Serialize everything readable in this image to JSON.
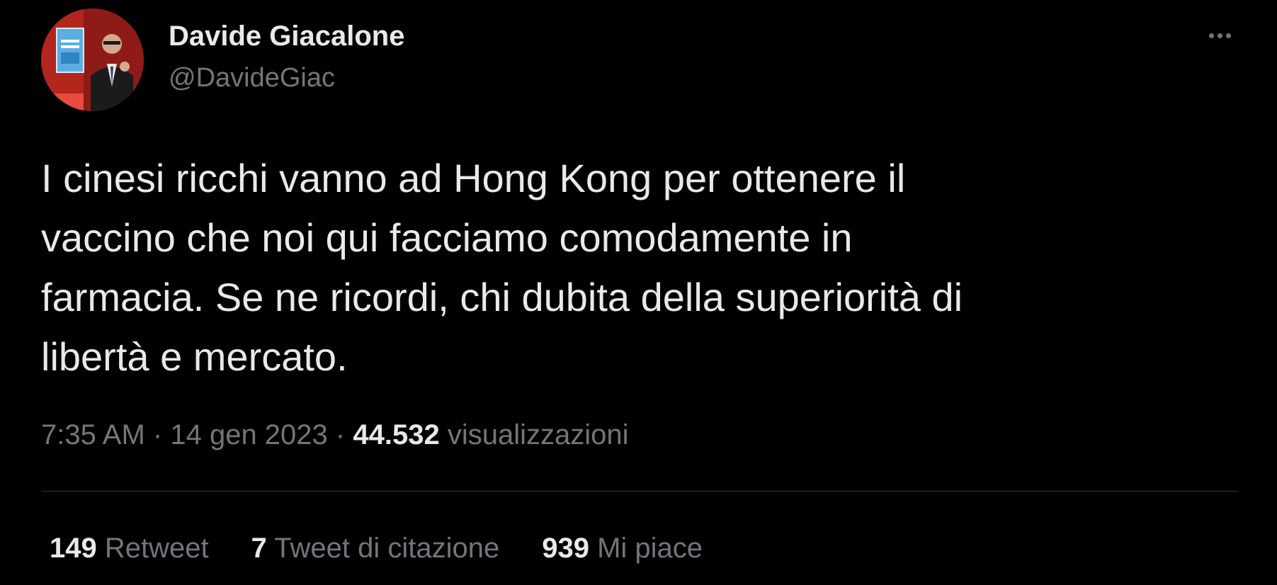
{
  "author": {
    "display_name": "Davide Giacalone",
    "handle": "@DavideGiac",
    "avatar_icon": "profile-photo"
  },
  "more_icon": "ellipsis-icon",
  "tweet": {
    "text": "I cinesi ricchi vanno ad Hong Kong per ottenere il\nvaccino che noi qui facciamo comodamente in\nfarmacia. Se ne ricordi, chi dubita della superiorità di\nlibertà e mercato."
  },
  "meta": {
    "time": "7:35 AM",
    "separator": "·",
    "date": "14 gen 2023",
    "views_count": "44.532",
    "views_label": "visualizzazioni"
  },
  "stats": {
    "retweets": {
      "count": "149",
      "label": "Retweet"
    },
    "quotes": {
      "count": "7",
      "label": "Tweet di citazione"
    },
    "likes": {
      "count": "939",
      "label": "Mi piace"
    }
  },
  "colors": {
    "background": "#000000",
    "primary_text": "#e7e9ea",
    "secondary_text": "#71767b",
    "divider": "#2f3336"
  }
}
